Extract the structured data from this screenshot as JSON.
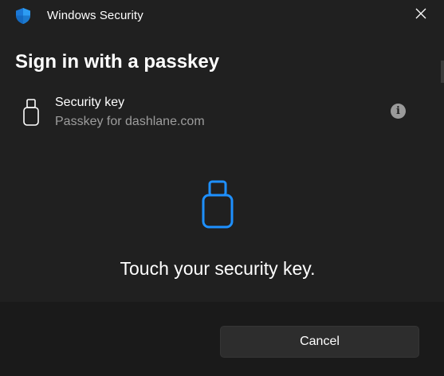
{
  "window": {
    "title": "Windows Security",
    "app_icon": "shield-icon",
    "close_icon": "close-icon"
  },
  "dialog": {
    "heading": "Sign in with a passkey"
  },
  "authenticator": {
    "icon": "usb-security-key-icon",
    "title": "Security key",
    "subtitle": "Passkey for dashlane.com",
    "info_icon": "info-icon",
    "info_glyph": "i"
  },
  "prompt": {
    "icon": "usb-security-key-icon",
    "text": "Touch your security key."
  },
  "footer": {
    "cancel_label": "Cancel"
  },
  "colors": {
    "background": "#202020",
    "footer_background": "#1a1a1a",
    "accent": "#1e90ff",
    "secondary_text": "#9d9d9d"
  }
}
